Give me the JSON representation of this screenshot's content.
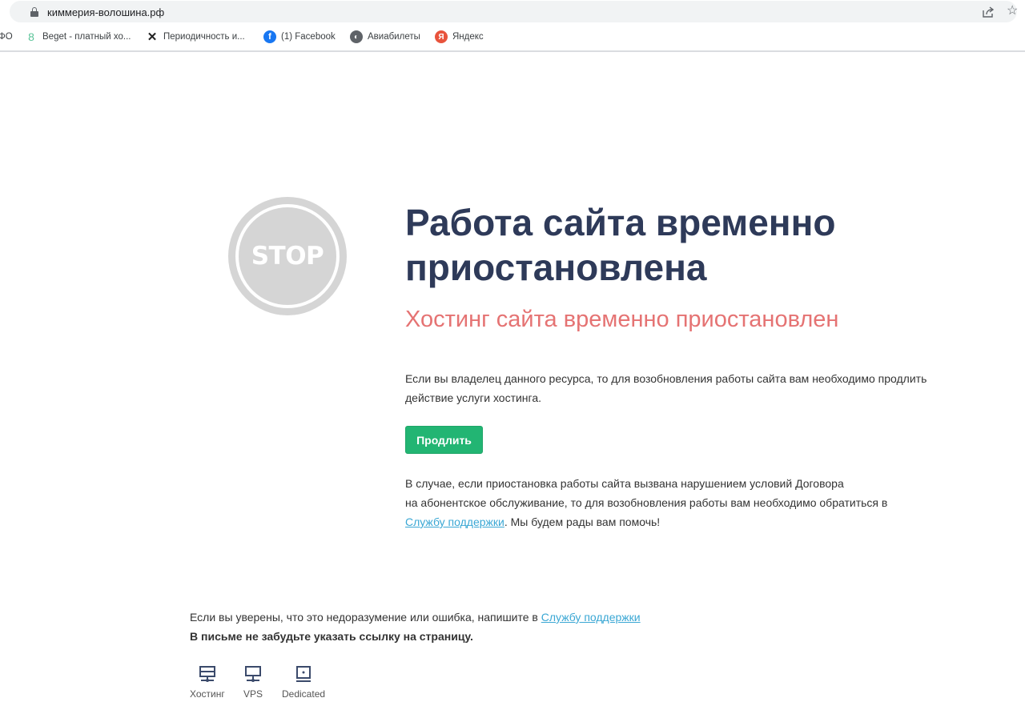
{
  "browser": {
    "url": "киммерия-волошина.рф",
    "bookmarks": [
      {
        "label": "ФО",
        "icon": "truncated-bookmark"
      },
      {
        "label": "Beget - платный хо...",
        "icon": "beget-icon"
      },
      {
        "label": "Периодичность и...",
        "icon": "tools-icon"
      },
      {
        "label": "(1) Facebook",
        "icon": "facebook-icon"
      },
      {
        "label": "Авиабилеты",
        "icon": "globe-icon"
      },
      {
        "label": "Яндекс",
        "icon": "yandex-icon"
      }
    ]
  },
  "page": {
    "stop_label": "STOP",
    "title": "Работа сайта временно приостановлена",
    "subtitle": "Хостинг сайта временно приостановлен",
    "paragraph1": "Если вы владелец данного ресурса, то для возобновления работы сайта вам необходимо продлить действие услуги хостинга.",
    "renew_button": "Продлить",
    "paragraph2_line1": "В случае, если приостановка работы сайта вызвана нарушением условий Договора",
    "paragraph2_line2": "на абонентское обслуживание, то для возобновления работы вам необходимо обратиться в",
    "paragraph2_link": "Службу поддержки",
    "paragraph2_end": ". Мы будем рады вам помочь!",
    "footer_text": "Если вы уверены, что это недоразумение или ошибка, напишите в ",
    "footer_link": "Службу поддержки",
    "footer_bold": "В письме не забудьте указать ссылку на страницу.",
    "services": [
      {
        "label": "Хостинг",
        "icon": "hosting-icon"
      },
      {
        "label": "VPS",
        "icon": "vps-icon"
      },
      {
        "label": "Dedicated",
        "icon": "dedicated-icon"
      }
    ]
  },
  "colors": {
    "title": "#2e3a59",
    "subtitle": "#e57373",
    "button": "#22b573",
    "link": "#3aa7d4",
    "stop": "#d5d5d5"
  }
}
